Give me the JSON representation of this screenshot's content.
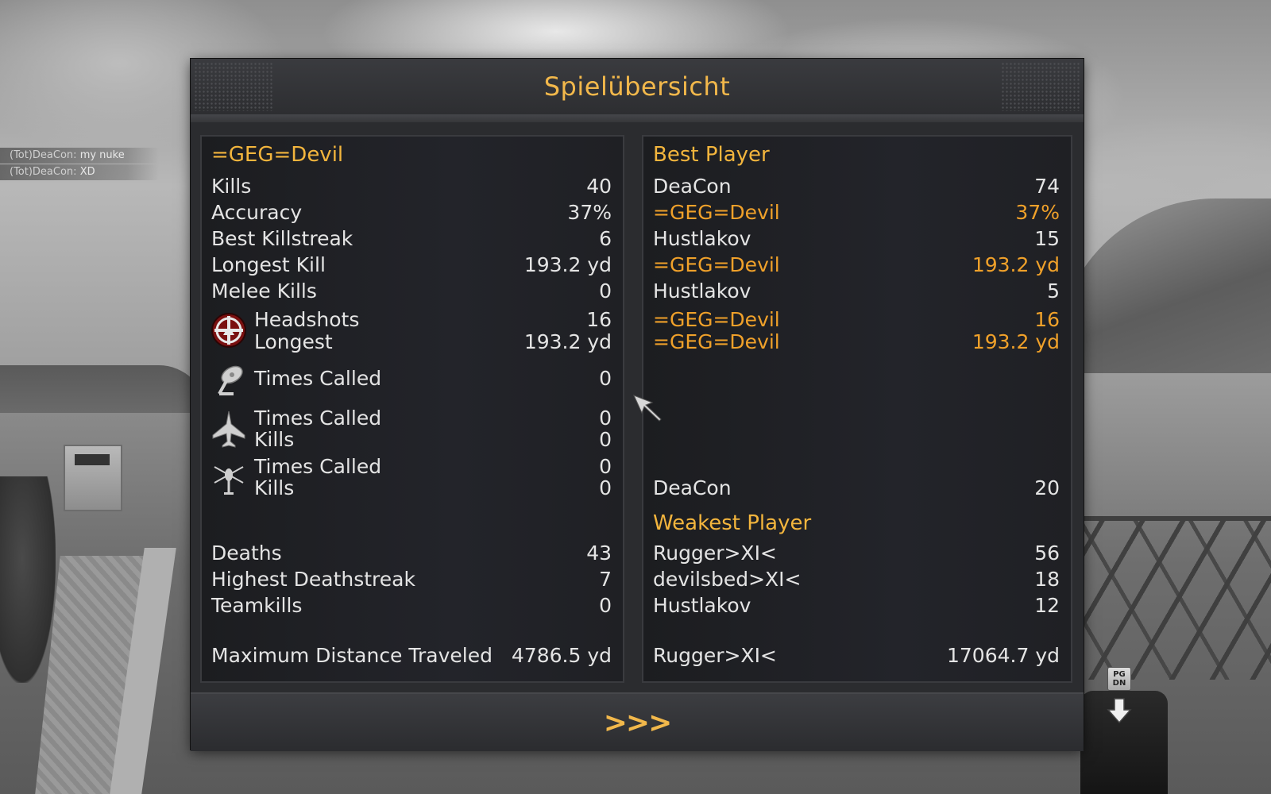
{
  "title": "Spielübersicht",
  "chat": [
    {
      "name": "(Tot)DeaCon:",
      "text": " my nuke"
    },
    {
      "name": "(Tot)DeaCon:",
      "text": "  XD"
    }
  ],
  "player": {
    "name": "=GEG=Devil",
    "kills_label": "Kills",
    "kills": "40",
    "accuracy_label": "Accuracy",
    "accuracy": "37%",
    "best_killstreak_label": "Best Killstreak",
    "best_killstreak": "6",
    "longest_kill_label": "Longest Kill",
    "longest_kill": "193.2 yd",
    "melee_label": "Melee Kills",
    "melee": "0",
    "headshots_label": "Headshots",
    "headshots": "16",
    "longest_hs_label": "Longest",
    "longest_hs": "193.2 yd",
    "uav_label": "Times Called",
    "uav": "0",
    "jet_called_label": "Times Called",
    "jet_called": "0",
    "jet_kills_label": "Kills",
    "jet_kills": "0",
    "heli_called_label": "Times Called",
    "heli_called": "0",
    "heli_kills_label": "Kills",
    "heli_kills": "0",
    "deaths_label": "Deaths",
    "deaths": "43",
    "deathstreak_label": "Highest Deathstreak",
    "deathstreak": "7",
    "teamkills_label": "Teamkills",
    "teamkills": "0",
    "distance_label": "Maximum Distance Traveled",
    "distance": "4786.5 yd"
  },
  "best": {
    "header": "Best Player",
    "kills_name": "DeaCon",
    "kills": "74",
    "accuracy_name": "=GEG=Devil",
    "accuracy": "37%",
    "killstreak_name": "Hustlakov",
    "killstreak": "15",
    "longest_name": "=GEG=Devil",
    "longest": "193.2 yd",
    "melee_name": "Hustlakov",
    "melee": "5",
    "headshots_name": "=GEG=Devil",
    "headshots": "16",
    "longest_hs_name": "=GEG=Devil",
    "longest_hs": "193.2 yd",
    "heli_kills_name": "DeaCon",
    "heli_kills": "20"
  },
  "weakest": {
    "header": "Weakest Player",
    "deaths_name": "Rugger>XI<",
    "deaths": "56",
    "deathstreak_name": "devilsbed>XI<",
    "deathstreak": "18",
    "teamkills_name": "Hustlakov",
    "teamkills": "12",
    "distance_name": "Rugger>XI<",
    "distance": "17064.7 yd"
  },
  "footer": {
    "next_label": ">>>"
  },
  "pgdn_label": "PG DN",
  "icons": {
    "headshot": "headshot-target-icon",
    "uav": "uav-satellite-icon",
    "jet": "jet-airstrike-icon",
    "heli": "helicopter-icon"
  },
  "colors": {
    "accent": "#f2b84b",
    "highlight": "#f0a12a",
    "text": "#e4e4e4",
    "panel": "#2b2c2f"
  }
}
